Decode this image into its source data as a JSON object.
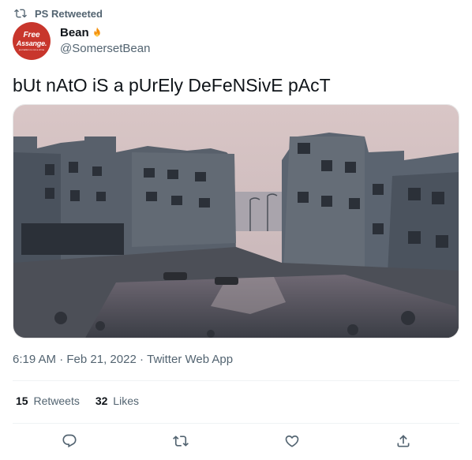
{
  "retweet_bar": {
    "label": "PS Retweeted",
    "icon": "retweet-icon"
  },
  "author": {
    "avatar": {
      "line1": "Free",
      "line2": "Assange.",
      "line3": "journalism is not a crime"
    },
    "display_name": "Bean",
    "name_emoji": "fire-icon",
    "handle": "@SomersetBean"
  },
  "tweet": {
    "text": "bUt nAtO iS a pUrEly DeFeNSivE pAcT",
    "media_icon": "destroyed-city-photo"
  },
  "meta": {
    "time": "6:19 AM",
    "sep1": " · ",
    "date": "Feb 21, 2022",
    "sep2": " · ",
    "source": "Twitter Web App"
  },
  "stats": {
    "retweets": {
      "count": "15",
      "label": "Retweets"
    },
    "likes": {
      "count": "32",
      "label": "Likes"
    }
  },
  "actions": [
    {
      "name": "reply",
      "icon": "reply-icon"
    },
    {
      "name": "retweet",
      "icon": "retweet-icon"
    },
    {
      "name": "like",
      "icon": "heart-icon"
    },
    {
      "name": "share",
      "icon": "share-icon"
    }
  ],
  "colors": {
    "secondary_text": "#536471",
    "primary_text": "#0f1419",
    "avatar_bg": "#c8362c"
  }
}
